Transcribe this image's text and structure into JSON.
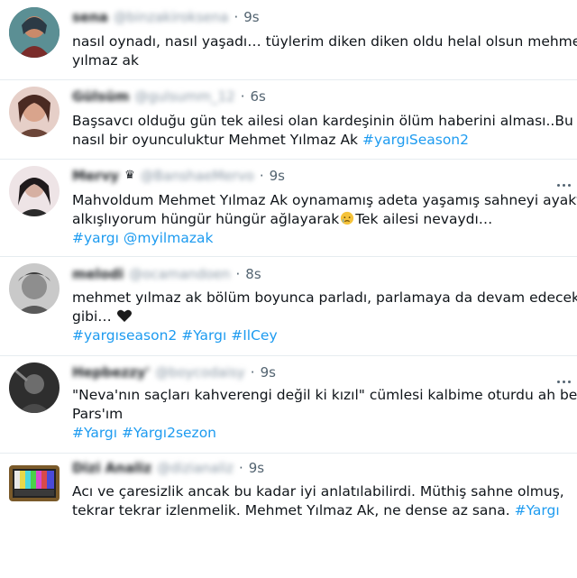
{
  "tweets": [
    {
      "name": "sena",
      "handle": "@binzakiroksena",
      "time": "9s",
      "lines": [
        "nasıl oynadı, nasıl yaşadı… tüylerim diken diken oldu helal olsun mehmet",
        "yılmaz ak"
      ]
    },
    {
      "name": "Gülsüm",
      "handle": "@gulsumm_12",
      "time": "6s",
      "lines": [
        "Başsavcı olduğu gün tek ailesi olan kardeşinin ölüm haberini alması..Bu",
        "nasıl bir oyunculuktur Mehmet Yılmaz Ak"
      ],
      "tag_inline": "#yargıSeason2"
    },
    {
      "name": "Mervy",
      "handle": "@BanshaeMervo",
      "time": "9s",
      "lines": [
        "Mahvoldum Mehmet Yılmaz Ak oynamamış adeta yaşamış sahneyi ayakta",
        "alkışlıyorum hüngür hüngür ağlayarak",
        "Tek ailesi nevaydı…"
      ],
      "tags": [
        "#yargı",
        "@myilmazak"
      ]
    },
    {
      "name": "melodi",
      "handle": "@ocamandoen",
      "time": "8s",
      "lines": [
        "mehmet yılmaz ak bölüm boyunca parladı, parlamaya da devam edecek",
        "gibi…"
      ],
      "tags": [
        "#yargıseason2",
        "#Yargı",
        "#IlCey"
      ]
    },
    {
      "name": "Hepbezzy'",
      "handle": "@boycodaisy",
      "time": "9s",
      "lines": [
        "\"Neva'nın saçları kahverengi değil ki kızıl\" cümlesi kalbime oturdu ah be",
        "Pars'ım"
      ],
      "tags": [
        "#Yargı",
        "#Yargı2sezon"
      ]
    },
    {
      "name": "Dizi Analiz",
      "handle": "@dizianaliz",
      "time": "9s",
      "lines": [
        "Acı ve çaresizlik ancak bu kadar iyi anlatılabilirdi. Müthiş sahne olmuş,",
        "tekrar tekrar izlenmelik. Mehmet Yılmaz Ak, ne dense az sana."
      ],
      "tag_inline": "#Yargı"
    }
  ]
}
